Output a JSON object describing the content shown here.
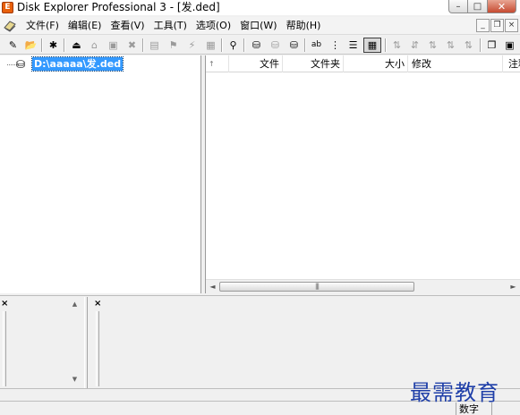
{
  "window": {
    "title": "Disk Explorer Professional 3 - [发.ded]",
    "app_icon_letter": "E",
    "minimize_glyph": "–",
    "maximize_glyph": "□",
    "close_glyph": "✕"
  },
  "menu": {
    "items": [
      "文件(F)",
      "编辑(E)",
      "查看(V)",
      "工具(T)",
      "选项(O)",
      "窗口(W)",
      "帮助(H)"
    ],
    "mdi_minimize_glyph": "_",
    "mdi_restore_glyph": "❐",
    "mdi_close_glyph": "×"
  },
  "toolbar": {
    "buttons": [
      {
        "icon": "new-catalog-icon",
        "glyph": "✎",
        "enabled": true
      },
      {
        "icon": "open-folder-icon",
        "glyph": "📂",
        "enabled": true
      },
      {
        "icon": "new-folder-icon",
        "glyph": "✱",
        "enabled": true
      },
      {
        "icon": "eject-disk-icon",
        "glyph": "⏏",
        "enabled": true
      },
      {
        "icon": "add-disk-icon",
        "glyph": "⌂",
        "enabled": false
      },
      {
        "icon": "disk-icon",
        "glyph": "▣",
        "enabled": false
      },
      {
        "icon": "delete-disk-icon",
        "glyph": "✖",
        "enabled": false
      },
      {
        "icon": "disk-properties-icon",
        "glyph": "▤",
        "enabled": false
      },
      {
        "icon": "scan-icon",
        "glyph": "⚑",
        "enabled": false
      },
      {
        "icon": "tools-icon",
        "glyph": "⚡",
        "enabled": false
      },
      {
        "icon": "print-icon",
        "glyph": "▦",
        "enabled": false
      },
      {
        "icon": "find-binoculars-icon",
        "glyph": "⚲",
        "enabled": true
      },
      {
        "icon": "drive-icon",
        "glyph": "⛁",
        "enabled": true
      },
      {
        "icon": "drive-disabled-icon",
        "glyph": "⛁",
        "enabled": false
      },
      {
        "icon": "drive-print-icon",
        "glyph": "⛁",
        "enabled": true
      },
      {
        "icon": "large-icons-view-icon",
        "glyph": "ab",
        "enabled": true
      },
      {
        "icon": "small-icons-view-icon",
        "glyph": "⋮",
        "enabled": true
      },
      {
        "icon": "list-view-icon",
        "glyph": "☰",
        "enabled": true
      },
      {
        "icon": "details-view-icon",
        "glyph": "▦",
        "enabled": true
      },
      {
        "icon": "sort-ascending-icon",
        "glyph": "⇅",
        "enabled": false
      },
      {
        "icon": "sort-name-icon",
        "glyph": "⇵",
        "enabled": false
      },
      {
        "icon": "sort-size-icon",
        "glyph": "⇅",
        "enabled": false
      },
      {
        "icon": "sort-date-icon",
        "glyph": "⇅",
        "enabled": false
      },
      {
        "icon": "sort-type-icon",
        "glyph": "⇅",
        "enabled": false
      },
      {
        "icon": "copy-icon",
        "glyph": "❐",
        "enabled": true
      },
      {
        "icon": "export-icon",
        "glyph": "▣",
        "enabled": true
      }
    ]
  },
  "tree": {
    "root_label": "D:\\aaaaa\\发.ded",
    "root_icon": "disk-drive-icon",
    "root_glyph": "⛁"
  },
  "list": {
    "sort_glyph": "↑",
    "columns": [
      "文件",
      "文件夹",
      "大小",
      "修改",
      "注释"
    ],
    "scroll_left_glyph": "◄",
    "scroll_right_glyph": "►",
    "thumb_grip": "|||"
  },
  "bottom": {
    "left_close": "×",
    "right_close": "×",
    "scroll_up_glyph": "▲",
    "scroll_down_glyph": "▼"
  },
  "status": {
    "num_lock": "数字"
  },
  "watermark": "最需教育"
}
